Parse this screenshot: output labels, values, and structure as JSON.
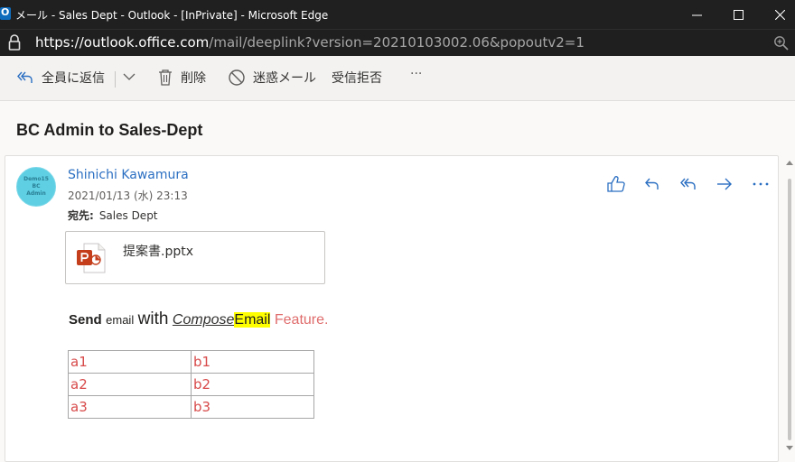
{
  "window": {
    "title": "メール - Sales Dept - Outlook - [InPrivate] - Microsoft Edge",
    "url_host": "https://outlook.office.com",
    "url_path": "/mail/deeplink?version=20210103002.06&popoutv2=1"
  },
  "toolbar": {
    "reply_all_label": "全員に返信",
    "delete_label": "削除",
    "junk_label": "迷惑メール",
    "block_label": "受信拒否",
    "more_label": "···"
  },
  "message": {
    "subject": "BC Admin to Sales-Dept",
    "avatar_lines": [
      "Demo15",
      "BC",
      "Admin"
    ],
    "sender": "Shinichi Kawamura",
    "date": "2021/01/13 (水) 23:13",
    "to_label": "宛先:",
    "to_value": "Sales Dept",
    "attachment_name": "提案書.pptx",
    "body": {
      "part1": "Send",
      "part2": "email",
      "part3": "with",
      "part4": "Compose",
      "part5": "Email",
      "part6": "Feature."
    },
    "table": [
      [
        "a1",
        "b1"
      ],
      [
        "a2",
        "b2"
      ],
      [
        "a3",
        "b3"
      ]
    ]
  },
  "colors": {
    "accent": "#2b6fc2",
    "table_text": "#d84a4a",
    "highlight": "#ffff00",
    "ppt_orange": "#c43e1c"
  },
  "icons": {
    "reply_all": "reply-all-icon",
    "delete": "trash-icon",
    "junk": "block-icon",
    "like": "thumbs-up-icon",
    "reply": "reply-icon",
    "forward": "forward-icon"
  }
}
